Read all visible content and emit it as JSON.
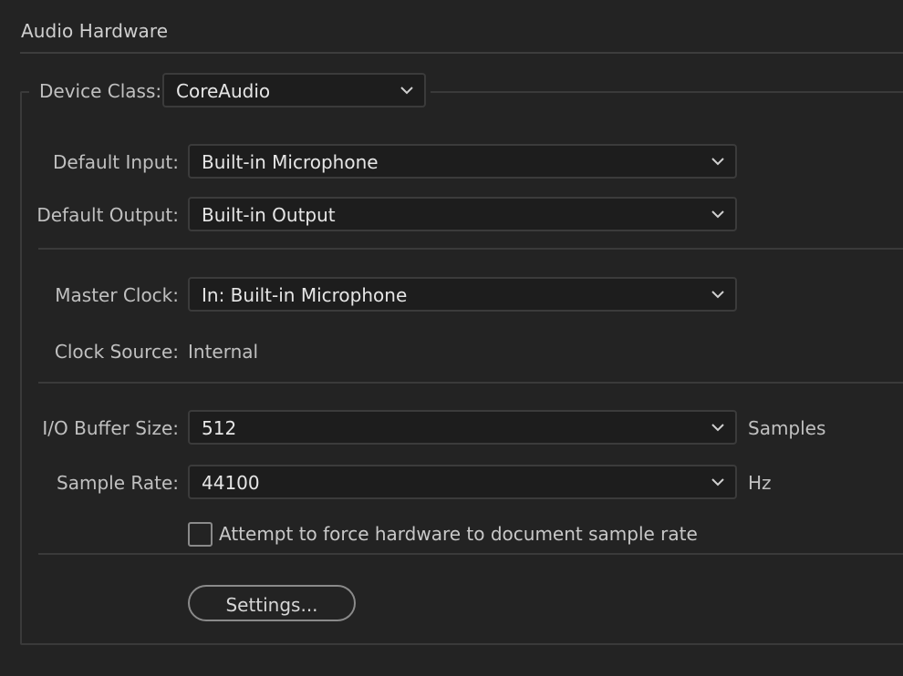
{
  "section": {
    "title": "Audio Hardware"
  },
  "device_class": {
    "label": "Device Class:",
    "value": "CoreAudio"
  },
  "default_input": {
    "label": "Default Input:",
    "value": "Built-in Microphone"
  },
  "default_output": {
    "label": "Default Output:",
    "value": "Built-in Output"
  },
  "master_clock": {
    "label": "Master Clock:",
    "value": "In: Built-in Microphone"
  },
  "clock_source": {
    "label": "Clock Source:",
    "value": "Internal"
  },
  "buffer_size": {
    "label": "I/O Buffer Size:",
    "value": "512",
    "unit": "Samples"
  },
  "sample_rate": {
    "label": "Sample Rate:",
    "value": "44100",
    "unit": "Hz"
  },
  "force_rate": {
    "label": "Attempt to force hardware to document sample rate",
    "checked": false
  },
  "settings_button": {
    "label": "Settings..."
  },
  "icons": {
    "dropdown": "chevron-down-icon"
  },
  "colors": {
    "background": "#232323",
    "field": "#1d1d1d",
    "border": "#3b3b3b",
    "text": "#c0c0c0",
    "value_text": "#e6e6e6"
  }
}
